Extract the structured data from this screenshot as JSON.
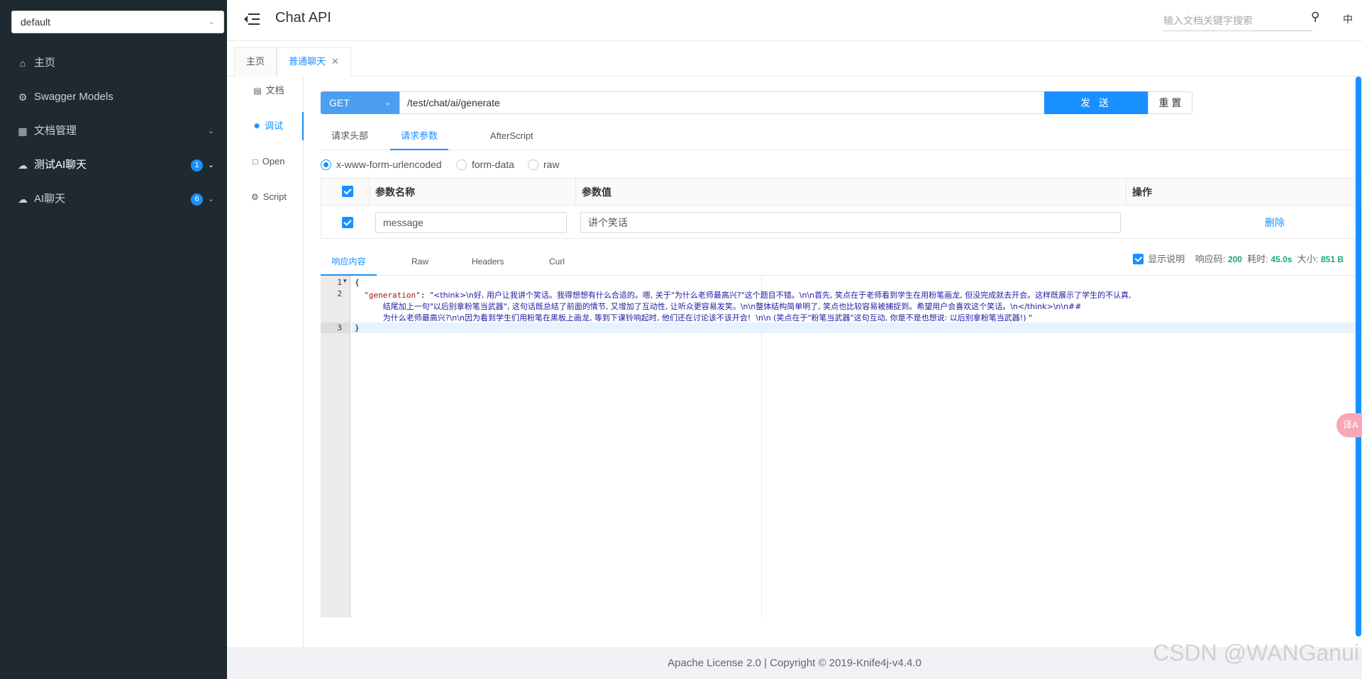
{
  "sidebar": {
    "group_select": "default",
    "items": [
      {
        "label": "主页",
        "icon": "home-icon"
      },
      {
        "label": "Swagger Models",
        "icon": "gear-icon"
      },
      {
        "label": "文档管理",
        "icon": "doc-icon"
      },
      {
        "label": "测试AI聊天",
        "icon": "cloud-icon",
        "badge": "1"
      },
      {
        "label": "AI聊天",
        "icon": "cloud-icon",
        "badge": "6"
      }
    ]
  },
  "header": {
    "title": "Chat API",
    "search_placeholder": "输入文档关键字搜索",
    "lang": "中"
  },
  "page_tabs": [
    {
      "label": "主页"
    },
    {
      "label": "普通聊天"
    }
  ],
  "submenu": [
    {
      "label": "文档"
    },
    {
      "label": "调试"
    },
    {
      "label": "Open"
    },
    {
      "label": "Script"
    }
  ],
  "request": {
    "method": "GET",
    "url": "/test/chat/ai/generate",
    "send_label": "发 送",
    "reset_label": "重 置",
    "tabs": [
      "请求头部",
      "请求参数",
      "AfterScript"
    ],
    "body_types": [
      "x-www-form-urlencoded",
      "form-data",
      "raw"
    ],
    "params_header": {
      "name": "参数名称",
      "value": "参数值",
      "action": "操作"
    },
    "params": [
      {
        "name": "message",
        "value": "讲个笑话",
        "action": "删除"
      }
    ]
  },
  "response": {
    "tabs": [
      "响应内容",
      "Raw",
      "Headers",
      "Curl"
    ],
    "show_desc_label": "显示说明",
    "status_label": "响应码:",
    "status_value": "200",
    "time_label": "耗时:",
    "time_value": "45.0s",
    "size_label": "大小:",
    "size_value": "851 B",
    "lines": {
      "l1": "{",
      "l2_key": "\"generation\"",
      "l2_a": "\"<think>\\n好, 用户让我讲个笑话。我得想想有什么合适的。嗯, 关于\"为什么老师最高兴?\"这个题目不错。\\n\\n首先, 笑点在于老师看到学生在用粉笔画龙, 但没完成就去开会。这样既展示了学生的不认真,",
      "l2_b": "结尾加上一句\"以后别拿粉笔当武器\", 这句话既总结了前面的情节, 又增加了互动性, 让听众更容易发笑。\\n\\n整体结构简单明了, 笑点也比较容易被捕捉到。希望用户会喜欢这个笑话。\\n</think>\\n\\n##",
      "l2_c": "为什么老师最高兴?\\n\\n因为看到学生们用粉笔在黑板上画龙, 等到下课铃响起时, 他们还在讨论该不该开会!  \\n\\n (笑点在于\"粉笔当武器\"这句互动, 你是不是也想说: 以后别拿粉笔当武器!) \"",
      "l3": "}"
    }
  },
  "footer": "Apache License 2.0 | Copyright © 2019-Knife4j-v4.4.0",
  "watermark": "CSDN @WANGanui",
  "translate_bubble": "译A"
}
